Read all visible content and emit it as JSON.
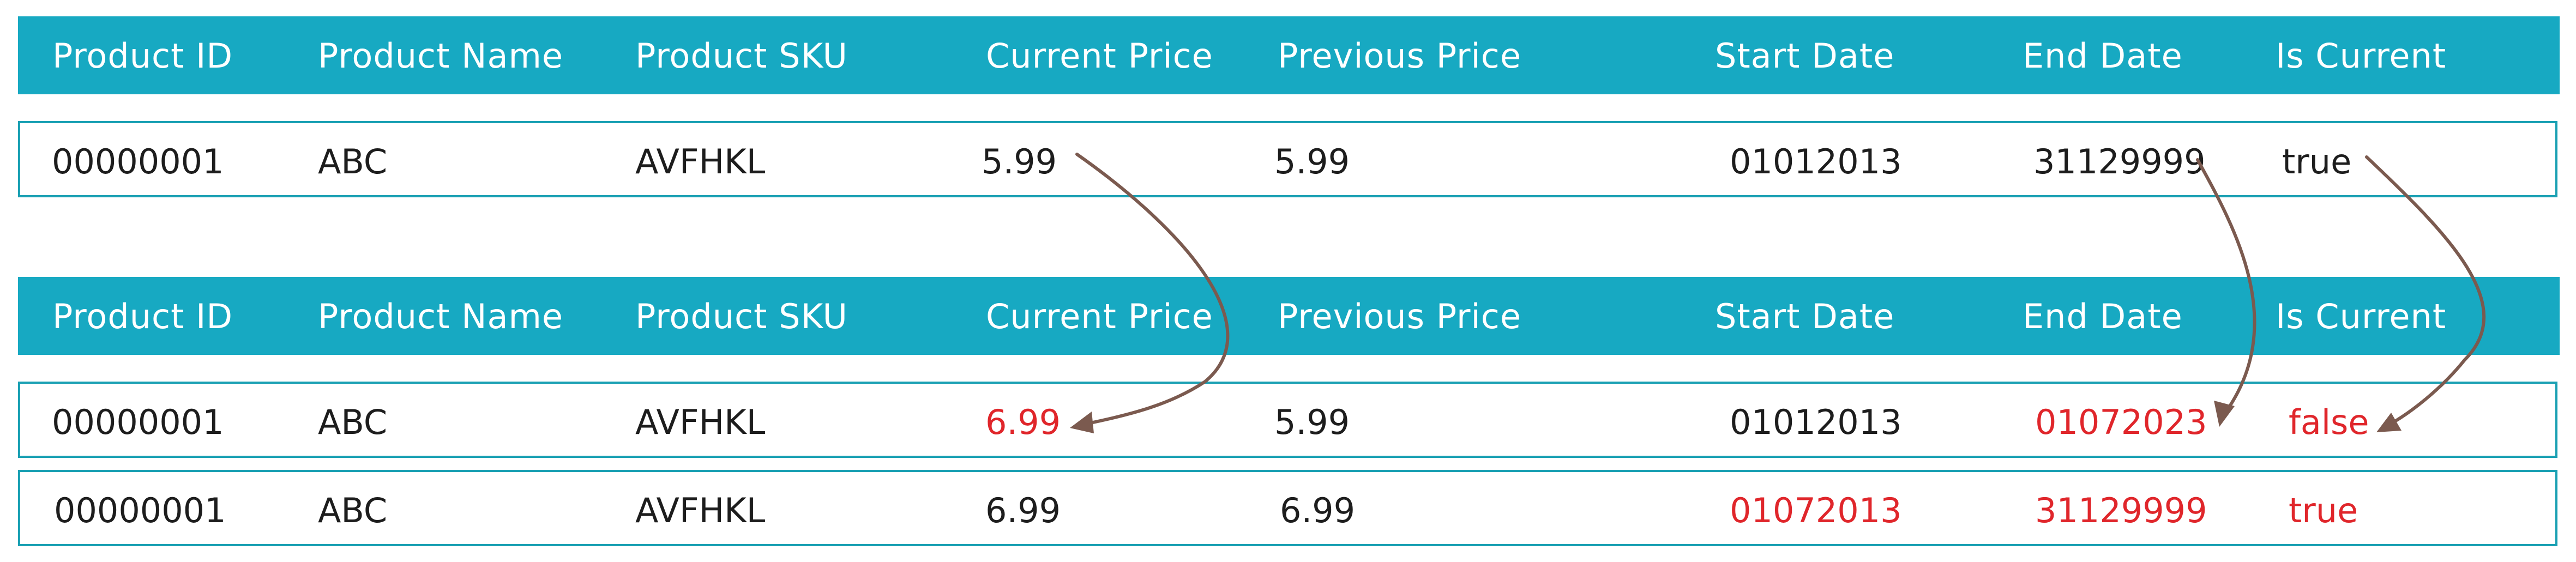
{
  "colors": {
    "header_bg": "#17a9c2",
    "row_border": "#1aa0b3",
    "changed_text": "#e0262b",
    "arrow": "#7b5a4f"
  },
  "table1": {
    "headers": [
      "Product ID",
      "Product Name",
      "Product SKU",
      "Current Price",
      "Previous Price",
      "Start Date",
      "End Date",
      "Is Current"
    ],
    "rows": [
      [
        "00000001",
        "ABC",
        "AVFHKL",
        "5.99",
        "5.99",
        "01012013",
        "31129999",
        "true"
      ]
    ]
  },
  "table2": {
    "headers": [
      "Product ID",
      "Product Name",
      "Product SKU",
      "Current Price",
      "Previous Price",
      "Start Date",
      "End Date",
      "Is Current"
    ],
    "rows": [
      [
        "00000001",
        "ABC",
        "AVFHKL",
        "6.99",
        "5.99",
        "01012013",
        "01072023",
        "false"
      ],
      [
        "00000001",
        "ABC",
        "AVFHKL",
        "6.99",
        "6.99",
        "01072013",
        "31129999",
        "true"
      ]
    ]
  }
}
